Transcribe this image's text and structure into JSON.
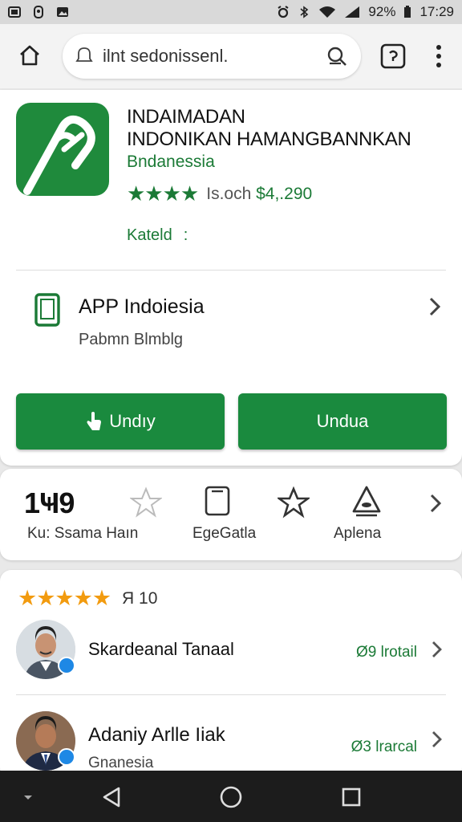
{
  "status_bar": {
    "battery": "92%",
    "time": "17:29"
  },
  "browser": {
    "url": "ilnt sedonissenl.",
    "icons": [
      "home-icon",
      "search-icon",
      "voice-search-icon",
      "tab-switcher-icon",
      "more-vert-icon"
    ]
  },
  "app": {
    "title_line1": "INDAIMADAN",
    "title_line2": "INDONIKAN HAMANGBANNKAN",
    "developer": "Bndanessia",
    "stars": "★★★★",
    "rating_label": "Is.och",
    "rating_value": "$4,.290",
    "kategori_label": "Kateld",
    "kategori_value": ":",
    "info_title": "APP Indoiesia",
    "info_subtitle": "Pabmn Blmblg",
    "button_primary": "Undıy",
    "button_secondary": "Undua",
    "accent": "#1a8a3e"
  },
  "stats": {
    "value": "1Ҹ9",
    "label_1": "Ku: Ssama Haın",
    "label_2": "EgeGatla",
    "label_3": "Aplena"
  },
  "reviews": {
    "stars": "★★★★★",
    "rating": "Я 10",
    "items": [
      {
        "name": "Skardeanal Tanaal",
        "subtitle": "",
        "meta": "Ø9 lrotail"
      },
      {
        "name": "Adaniy Arlle Iiak",
        "subtitle": "Gnanesia",
        "meta": "Ø3 lrarcal"
      }
    ]
  },
  "nav": {
    "icons": [
      "keyboard-hide-icon",
      "back-icon",
      "home-circle-icon",
      "recents-icon"
    ]
  }
}
